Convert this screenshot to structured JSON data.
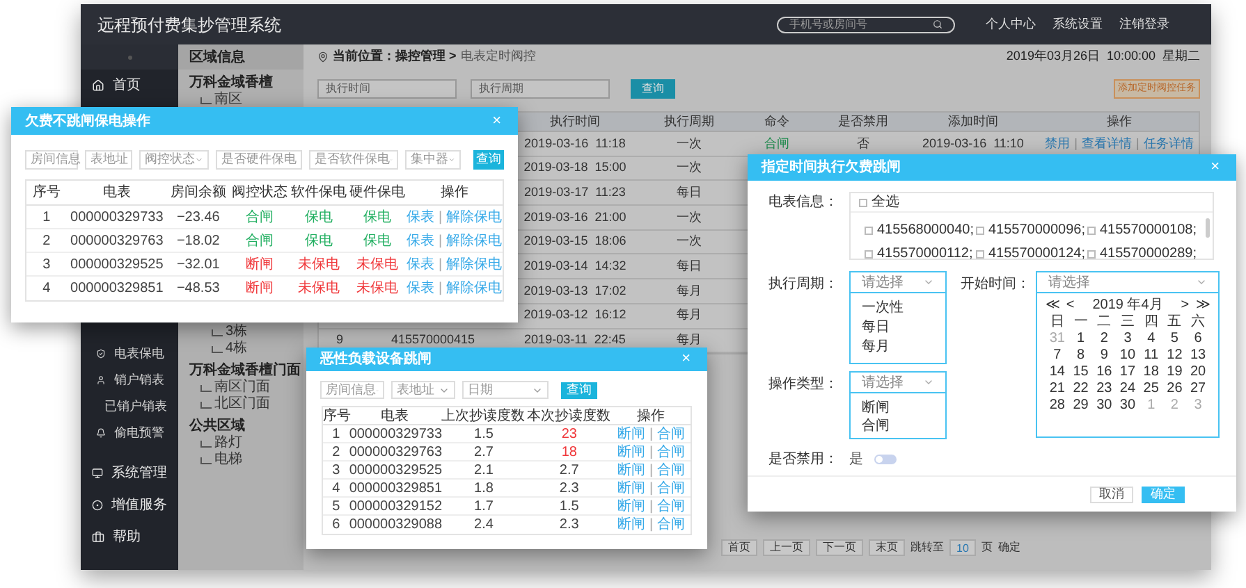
{
  "app": {
    "title": "远程预付费集抄管理系统",
    "search": {
      "placeholder": "手机号或房间号"
    },
    "header_links": [
      "个人中心",
      "系统设置",
      "注销登录"
    ]
  },
  "sidebar": {
    "items": [
      {
        "label": "首页",
        "kind": "main"
      },
      {
        "label": "电表保电",
        "kind": "sub"
      },
      {
        "label": "销户销表",
        "kind": "sub"
      },
      {
        "label": "已销户销表",
        "kind": "sub"
      },
      {
        "label": "偷电预警",
        "kind": "sub"
      },
      {
        "label": "系统管理",
        "kind": "main"
      },
      {
        "label": "增值服务",
        "kind": "main"
      },
      {
        "label": "帮助",
        "kind": "main"
      }
    ]
  },
  "tree": {
    "title": "区域信息",
    "nodes": [
      {
        "label": "万科金域香檀",
        "children": [
          {
            "label": "南区",
            "children": [
              {
                "label": "3栋"
              },
              {
                "label": "4栋"
              }
            ]
          }
        ]
      },
      {
        "label": "万科金域香檀门面",
        "children": [
          {
            "label": "南区门面"
          },
          {
            "label": "北区门面"
          }
        ]
      },
      {
        "label": "公共区域",
        "children": [
          {
            "label": "路灯"
          },
          {
            "label": "电梯"
          }
        ]
      }
    ]
  },
  "breadcrumb": {
    "prefix": "当前位置：",
    "section": "操控管理",
    "separator": ">",
    "page": "电表定时阀控"
  },
  "datetime": "2019年03月26日  10:00:00  星期二",
  "filters": [
    {
      "placeholder": "执行时间"
    },
    {
      "placeholder": "执行周期"
    }
  ],
  "query_button": "查询",
  "add_button": "添加定时阀控任务",
  "table": {
    "action_separator": "|",
    "columns": [
      "执行时间",
      "执行周期",
      "命令",
      "是否禁用",
      "添加时间",
      "操作"
    ],
    "rows": [
      {
        "time": "2019-03-16  11:18",
        "period": "一次",
        "command": "合闸",
        "disabled": "否",
        "added": "2019-03-16  11:10",
        "actions": [
          "禁用",
          "查看详情",
          "任务详情"
        ]
      },
      {
        "time": "2019-03-18  15:00",
        "period": "一次"
      },
      {
        "time": "2019-03-17  11:23",
        "period": "每日"
      },
      {
        "time": "2019-03-16  21:00",
        "period": "一次"
      },
      {
        "time": "2019-03-15  18:06",
        "period": "一次"
      },
      {
        "time": "2019-03-14  14:32",
        "period": "每日"
      },
      {
        "time": "2019-03-13  17:02",
        "period": "每月"
      },
      {
        "time": "2019-03-12  16:12",
        "period": "每月"
      },
      {
        "no": "9",
        "meter": "415570000415",
        "time": "2019-03-11  22:45",
        "period": "每月"
      }
    ]
  },
  "pagination": {
    "buttons": [
      "首页",
      "上一页",
      "下一页",
      "末页"
    ],
    "jump_label": "跳转至",
    "page": "10",
    "unit": "页",
    "confirm": "确定"
  },
  "dialog_protect": {
    "title": "欠费不跳闸保电操作",
    "close": "×",
    "action_separator": "|",
    "filters": [
      {
        "placeholder": "房间信息",
        "kind": "input"
      },
      {
        "placeholder": "表地址",
        "kind": "input"
      },
      {
        "placeholder": "阀控状态",
        "kind": "select"
      },
      {
        "placeholder": "是否硬件保电",
        "kind": "select"
      },
      {
        "placeholder": "是否软件保电",
        "kind": "select"
      },
      {
        "placeholder": "集中器",
        "kind": "select"
      }
    ],
    "query": "查询",
    "columns": [
      "序号",
      "电表",
      "房间余额",
      "阀控状态",
      "软件保电",
      "硬件保电",
      "操作"
    ],
    "rows": [
      {
        "no": "1",
        "meter": "000000329733",
        "balance": "−23.46",
        "valve": "合闸",
        "soft": "保电",
        "hard": "保电",
        "alarm": false,
        "actions": [
          "保表",
          "解除保电"
        ]
      },
      {
        "no": "2",
        "meter": "000000329763",
        "balance": "−18.02",
        "valve": "合闸",
        "soft": "保电",
        "hard": "保电",
        "alarm": false,
        "actions": [
          "保表",
          "解除保电"
        ]
      },
      {
        "no": "3",
        "meter": "000000329525",
        "balance": "−32.01",
        "valve": "断闸",
        "soft": "未保电",
        "hard": "未保电",
        "alarm": true,
        "actions": [
          "保表",
          "解除保电"
        ]
      },
      {
        "no": "4",
        "meter": "000000329851",
        "balance": "−48.53",
        "valve": "断闸",
        "soft": "未保电",
        "hard": "未保电",
        "alarm": true,
        "actions": [
          "保表",
          "解除保电"
        ]
      }
    ]
  },
  "dialog_load": {
    "title": "恶性负载设备跳闸",
    "close": "×",
    "action_separator": "|",
    "filters": [
      {
        "placeholder": "房间信息"
      },
      {
        "placeholder": "表地址"
      },
      {
        "placeholder": "日期"
      }
    ],
    "query": "查询",
    "columns": [
      "序号",
      "电表",
      "上次抄读度数",
      "本次抄读度数",
      "操作"
    ],
    "rows": [
      {
        "no": "1",
        "meter": "000000329733",
        "last": "1.5",
        "current": "23",
        "over": true,
        "actions": [
          "断闸",
          "合闸"
        ]
      },
      {
        "no": "2",
        "meter": "000000329763",
        "last": "2.7",
        "current": "18",
        "over": true,
        "actions": [
          "断闸",
          "合闸"
        ]
      },
      {
        "no": "3",
        "meter": "000000329525",
        "last": "2.1",
        "current": "2.7",
        "over": false,
        "actions": [
          "断闸",
          "合闸"
        ]
      },
      {
        "no": "4",
        "meter": "000000329851",
        "last": "1.8",
        "current": "2.3",
        "over": false,
        "actions": [
          "断闸",
          "合闸"
        ]
      },
      {
        "no": "5",
        "meter": "000000329152",
        "last": "1.7",
        "current": "1.5",
        "over": false,
        "actions": [
          "断闸",
          "合闸"
        ]
      },
      {
        "no": "6",
        "meter": "000000329088",
        "last": "2.4",
        "current": "2.3",
        "over": false,
        "actions": [
          "断闸",
          "合闸"
        ]
      }
    ]
  },
  "dialog_schedule": {
    "title": "指定时间执行欠费跳闸",
    "close": "×",
    "meter_label": "电表信息：",
    "select_all": {
      "label": "全选",
      "checked": false
    },
    "meters": [
      {
        "label": "415568000040;",
        "checked": false
      },
      {
        "label": "415570000096;",
        "checked": false
      },
      {
        "label": "415570000108;",
        "checked": false
      },
      {
        "label": "415570000112;",
        "checked": false
      },
      {
        "label": "415570000124;",
        "checked": false
      },
      {
        "label": "415570000289;",
        "checked": false
      }
    ],
    "period": {
      "label": "执行周期：",
      "placeholder": "请选择",
      "options": [
        "一次性",
        "每日",
        "每月"
      ]
    },
    "start": {
      "label": "开始时间：",
      "placeholder": "请选择"
    },
    "calendar": {
      "nav_prev": [
        "≪",
        "<"
      ],
      "month": "2019 年4月",
      "nav_next": [
        ">",
        "≫"
      ],
      "weekdays": [
        "日",
        "一",
        "二",
        "三",
        "四",
        "五",
        "六"
      ],
      "days": [
        {
          "day": "31",
          "other": true
        },
        {
          "day": "1",
          "other": false
        },
        {
          "day": "2",
          "other": false
        },
        {
          "day": "3",
          "other": false
        },
        {
          "day": "4",
          "other": false
        },
        {
          "day": "5",
          "other": false
        },
        {
          "day": "6",
          "other": false
        },
        {
          "day": "7",
          "other": false
        },
        {
          "day": "8",
          "other": false
        },
        {
          "day": "9",
          "other": false
        },
        {
          "day": "10",
          "other": false
        },
        {
          "day": "11",
          "other": false
        },
        {
          "day": "12",
          "other": false
        },
        {
          "day": "13",
          "other": false
        },
        {
          "day": "14",
          "other": false
        },
        {
          "day": "15",
          "other": false
        },
        {
          "day": "16",
          "other": false
        },
        {
          "day": "17",
          "other": false
        },
        {
          "day": "18",
          "other": false
        },
        {
          "day": "19",
          "other": false
        },
        {
          "day": "20",
          "other": false
        },
        {
          "day": "21",
          "other": false
        },
        {
          "day": "22",
          "other": false
        },
        {
          "day": "23",
          "other": false
        },
        {
          "day": "24",
          "other": false
        },
        {
          "day": "25",
          "other": false
        },
        {
          "day": "26",
          "other": false
        },
        {
          "day": "27",
          "other": false
        },
        {
          "day": "28",
          "other": false
        },
        {
          "day": "29",
          "other": false
        },
        {
          "day": "30",
          "other": false
        },
        {
          "day": "30",
          "other": false
        },
        {
          "day": "1",
          "other": true
        },
        {
          "day": "2",
          "other": true
        },
        {
          "day": "3",
          "other": true
        }
      ]
    },
    "op_type": {
      "label": "操作类型：",
      "placeholder": "请选择",
      "options": [
        "断闸",
        "合闸"
      ]
    },
    "disable": {
      "label": "是否禁用：",
      "value": "是",
      "on": false
    },
    "buttons": [
      {
        "label": "取消",
        "primary": false
      },
      {
        "label": "确定",
        "primary": true
      }
    ]
  }
}
